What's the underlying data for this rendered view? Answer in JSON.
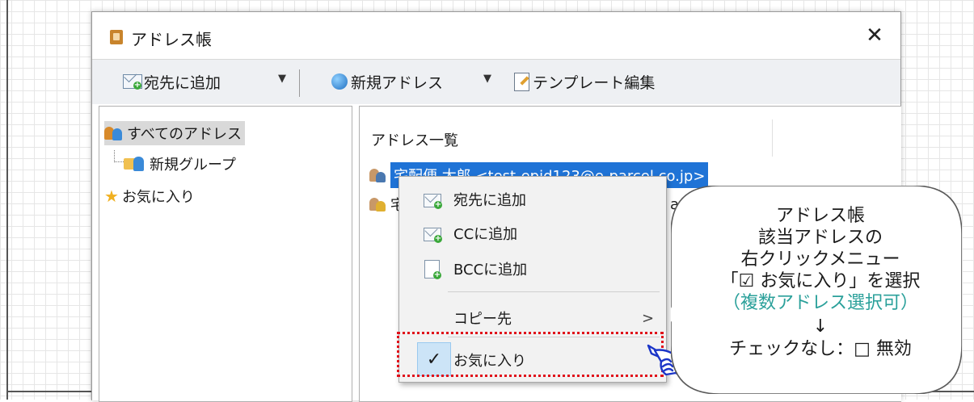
{
  "window": {
    "title": "アドレス帳",
    "close_glyph": "✕"
  },
  "toolbar": {
    "add_to_label": "宛先に追加",
    "new_address_label": "新規アドレス",
    "template_edit_label": "テンプレート編集",
    "dropdown_glyph": "▼"
  },
  "tree": {
    "items": [
      {
        "label": "すべてのアドレス",
        "icon": "people-icon",
        "selected": true
      },
      {
        "label": "新規グループ",
        "icon": "folder-people-icon"
      },
      {
        "label": "お気に入り",
        "icon": "star-icon"
      }
    ]
  },
  "address_list": {
    "header": "アドレス一覧",
    "rows": [
      {
        "text": "宅配便 太郎 <test-epid123@e-parcel.co.jp>",
        "selected": true
      },
      {
        "text": "宅",
        "trailing": "arc",
        "selected": false
      }
    ]
  },
  "context_menu": {
    "items": [
      {
        "label": "宛先に追加",
        "icon": "envelope-add-icon"
      },
      {
        "label": "CCに追加",
        "icon": "envelope-add-icon"
      },
      {
        "label": "BCCに追加",
        "icon": "document-add-icon"
      },
      {
        "label": "コピー先",
        "submenu_glyph": ">"
      },
      {
        "label": "お気に入り",
        "checked": true,
        "check_glyph": "✓"
      }
    ]
  },
  "callout": {
    "lines": [
      "アドレス帳",
      "該当アドレスの",
      "右クリックメニュー",
      "「☑ お気に入り」を選択",
      "（複数アドレス選択可）",
      "↓",
      "チェックなし：□ 無効"
    ],
    "accent_color": "#2aa09a"
  },
  "colors": {
    "selection_blue": "#1f73d6",
    "highlight_red": "#e0101a",
    "check_bg": "#cce4f7"
  }
}
